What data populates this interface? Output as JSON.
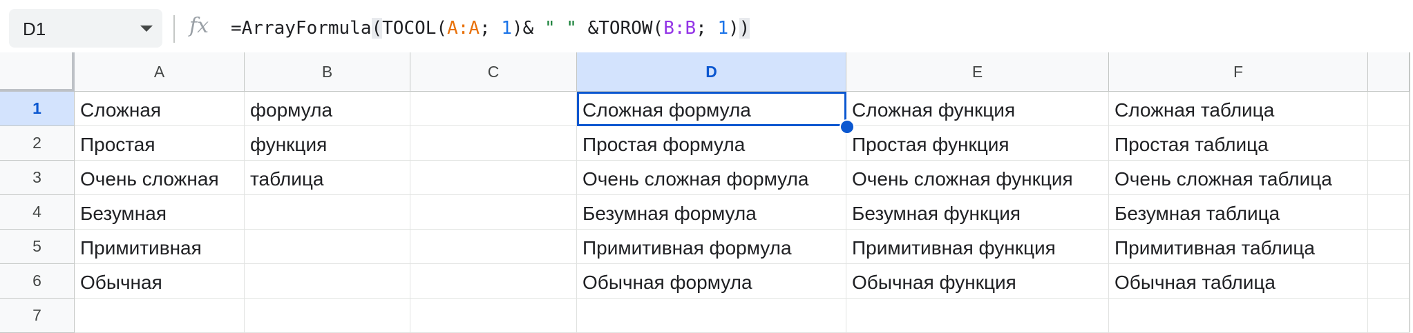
{
  "name_box": {
    "value": "D1"
  },
  "formula_bar": {
    "fx_icon": "fx",
    "formula_parts": [
      {
        "text": "=ArrayFormula",
        "color": "default"
      },
      {
        "text": "(",
        "color": "highlight"
      },
      {
        "text": "TOCOL(",
        "color": "default"
      },
      {
        "text": "A:A",
        "color": "orange"
      },
      {
        "text": "; ",
        "color": "default"
      },
      {
        "text": "1",
        "color": "blue"
      },
      {
        "text": ")& ",
        "color": "default"
      },
      {
        "text": "\" \"",
        "color": "green"
      },
      {
        "text": " &TOROW(",
        "color": "default"
      },
      {
        "text": "B:B",
        "color": "purple"
      },
      {
        "text": "; ",
        "color": "default"
      },
      {
        "text": "1",
        "color": "blue"
      },
      {
        "text": ")",
        "color": "default"
      },
      {
        "text": ")",
        "color": "highlight"
      }
    ]
  },
  "columns": [
    "A",
    "B",
    "C",
    "D",
    "E",
    "F"
  ],
  "selected_column": "D",
  "rows": [
    "1",
    "2",
    "3",
    "4",
    "5",
    "6",
    "7"
  ],
  "selected_row": "1",
  "cells": [
    [
      "Сложная",
      "формула",
      "",
      "Сложная формула",
      "Сложная функция",
      "Сложная таблица"
    ],
    [
      "Простая",
      "функция",
      "",
      "Простая формула",
      "Простая функция",
      "Простая таблица"
    ],
    [
      "Очень сложная",
      "таблица",
      "",
      "Очень сложная формула",
      "Очень сложная функция",
      "Очень сложная таблица"
    ],
    [
      "Безумная",
      "",
      "",
      "Безумная формула",
      "Безумная функция",
      "Безумная таблица"
    ],
    [
      "Примитивная",
      "",
      "",
      "Примитивная формула",
      "Примитивная функция",
      "Примитивная таблица"
    ],
    [
      "Обычная",
      "",
      "",
      "Обычная формула",
      "Обычная функция",
      "Обычная таблица"
    ],
    [
      "",
      "",
      "",
      "",
      "",
      ""
    ]
  ],
  "colors": {
    "selection": "#0b57d0",
    "selected_header_bg": "#d3e3fd",
    "ref_orange": "#e8710a",
    "ref_purple": "#9334e6",
    "number_blue": "#1a73e8",
    "string_green": "#188038"
  }
}
